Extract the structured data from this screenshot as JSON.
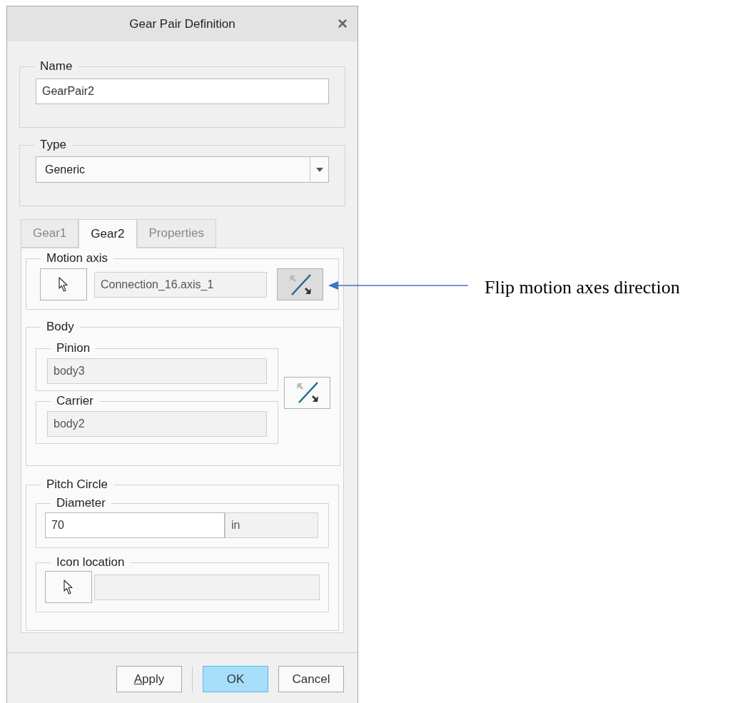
{
  "window": {
    "title": "Gear Pair Definition",
    "close": "×"
  },
  "name_group": {
    "label": "Name",
    "field": {
      "value": "GearPair2",
      "editable": true
    }
  },
  "type_group": {
    "label": "Type",
    "dropdown": {
      "value": "Generic"
    }
  },
  "tabs": [
    {
      "label": "Gear1",
      "selected": false
    },
    {
      "label": "Gear2",
      "selected": true
    },
    {
      "label": "Properties",
      "selected": false
    }
  ],
  "motion_axis": {
    "label": "Motion axis",
    "field": {
      "value": "Connection_16.axis_1",
      "editable": false
    },
    "flip_pressed": true
  },
  "body": {
    "label": "Body",
    "pinion": {
      "label": "Pinion",
      "field": {
        "value": "body3",
        "editable": false
      }
    },
    "carrier": {
      "label": "Carrier",
      "field": {
        "value": "body2",
        "editable": false
      }
    },
    "flip_pressed": false
  },
  "pitch_circle": {
    "label": "Pitch Circle",
    "diameter": {
      "label": "Diameter",
      "field": {
        "value": "70",
        "editable": true
      },
      "unit": {
        "value": "in",
        "editable": false
      }
    },
    "icon_location": {
      "label": "Icon location",
      "field": {
        "editable": false
      }
    }
  },
  "buttons": [
    {
      "label": "Apply",
      "mnemonic_underlined": true,
      "default": false
    },
    {
      "label": "OK",
      "default": true
    },
    {
      "label": "Cancel",
      "default": false
    }
  ],
  "callout": {
    "text": "Flip motion axes direction"
  }
}
